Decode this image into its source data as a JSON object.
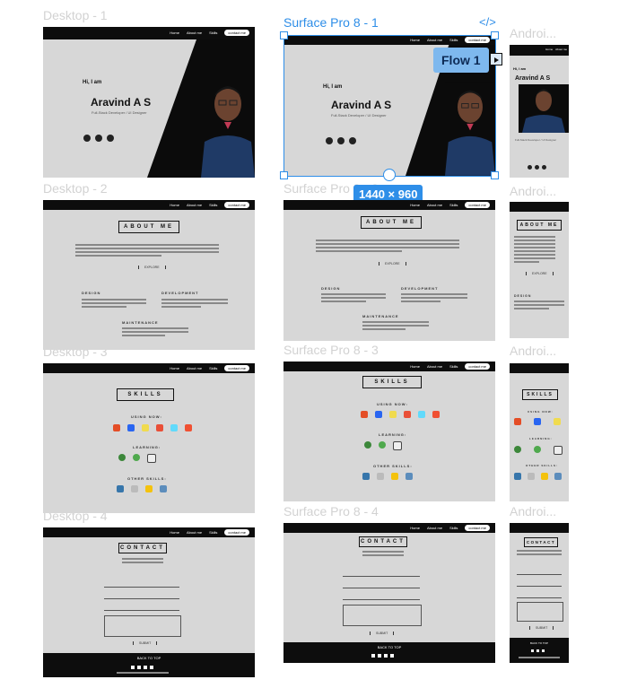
{
  "frame_labels": {
    "desktop1": "Desktop - 1",
    "desktop2": "Desktop - 2",
    "desktop3": "Desktop - 3",
    "desktop4": "Desktop - 4",
    "surface1": "Surface Pro 8 - 1",
    "surface2": "Surface Pro 8 - 2",
    "surface3": "Surface Pro 8 - 3",
    "surface4": "Surface Pro 8 - 4",
    "android1": "Androi...",
    "android2": "Androi...",
    "android3": "Androi...",
    "android4": "Androi..."
  },
  "nav": {
    "home": "Home",
    "about": "About me",
    "skills": "Skills",
    "contact": "contact me"
  },
  "hero": {
    "greeting": "Hi, I am",
    "name": "Aravind A S",
    "role": "Full-Stack Developer / UI Designer"
  },
  "about": {
    "title": "ABOUT ME",
    "explore": "EXPLORE",
    "design": "DESIGN",
    "development": "DEVELOPMENT",
    "maintenance": "MAINTENANCE"
  },
  "skills": {
    "title": "SKILLS",
    "using_now": "USING NOW:",
    "learning": "LEARNING:",
    "other": "OTHER SKILLS:"
  },
  "contact": {
    "title": "CONTACT",
    "submit": "SUBMIT",
    "back_to_top": "BACK TO TOP"
  },
  "prototype": {
    "flow_label": "Flow 1",
    "dimensions": "1440 × 960",
    "code_icon": "</>"
  },
  "colors": {
    "selection": "#2e8ee8",
    "frame_bg": "#d7d7d7",
    "dark": "#0d0d0d"
  }
}
